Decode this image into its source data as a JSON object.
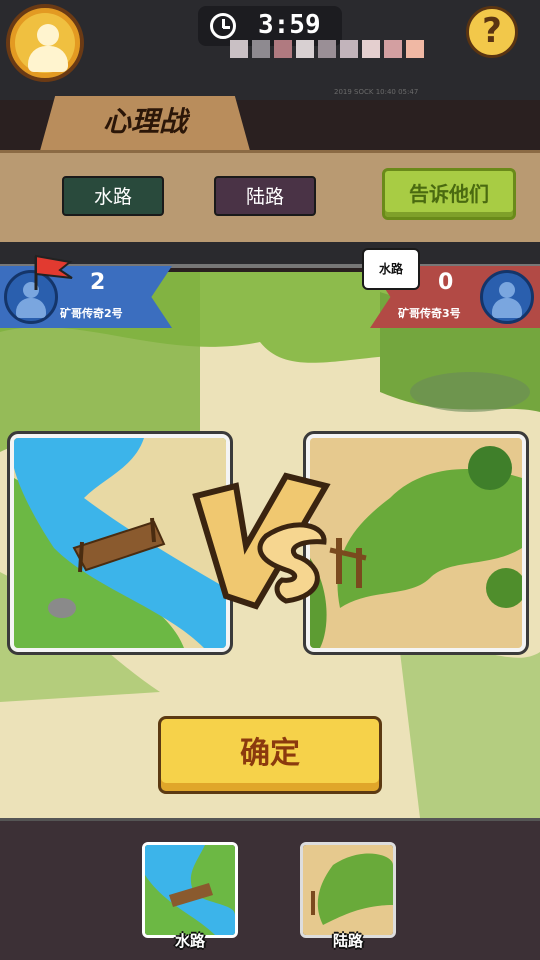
{
  "timer": {
    "time": "3:59"
  },
  "help": {
    "label": "?"
  },
  "mode": {
    "title": "心理战"
  },
  "choices": {
    "water": "水路",
    "land": "陆路",
    "tell": "告诉他们"
  },
  "players": {
    "left": {
      "score": "2",
      "name": "矿哥传奇2号"
    },
    "right": {
      "score": "0",
      "name": "矿哥传奇3号",
      "bubble": "水路"
    }
  },
  "confirm": {
    "label": "确定"
  },
  "thumbnails": [
    {
      "label": "水路"
    },
    {
      "label": "陆路"
    }
  ],
  "blurred_text": "2019 SOCK 10:40 05:47",
  "colors": {
    "left_team": "#3b6ebf",
    "right_team": "#b24a45",
    "confirm": "#f6d24a",
    "tell": "#a8cc44"
  }
}
